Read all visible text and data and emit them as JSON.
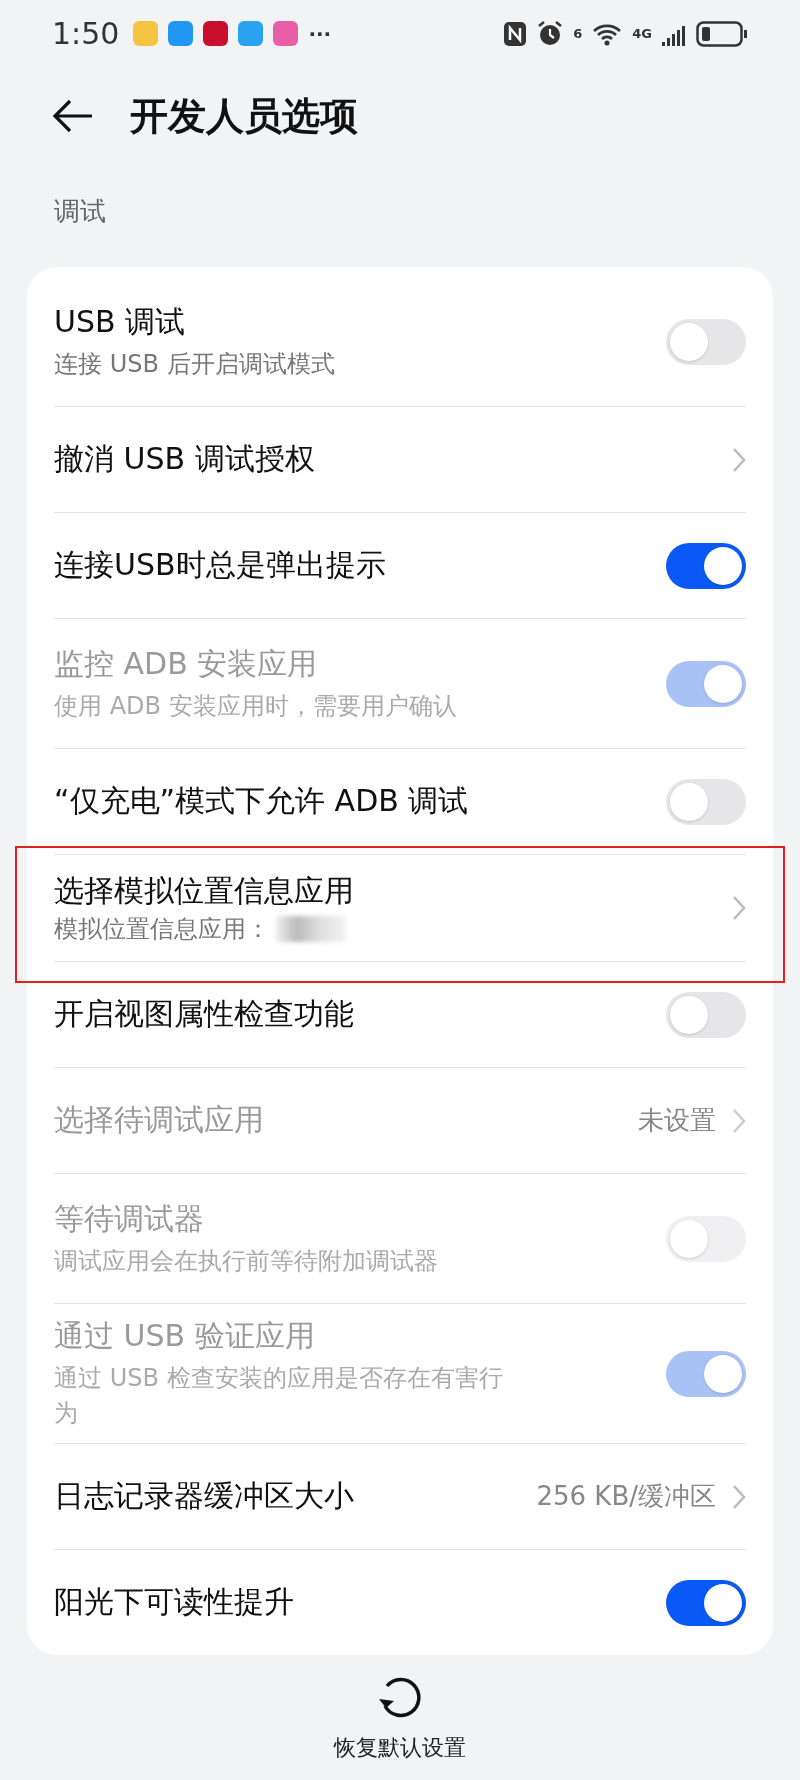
{
  "status_bar": {
    "time": "1:50",
    "more": "···",
    "apps": [
      {
        "color": "#f5c542"
      },
      {
        "color": "#2196f3"
      },
      {
        "color": "#c8102e"
      },
      {
        "color": "#29a3f0"
      },
      {
        "color": "#e85fa8"
      }
    ],
    "wifi_badge": "6",
    "network": "4G"
  },
  "header": {
    "title": "开发人员选项"
  },
  "section": {
    "title": "调试"
  },
  "rows": [
    {
      "kind": "switch",
      "title": "USB 调试",
      "subtitle": "连接 USB 后开启调试模式",
      "on": false,
      "disabled": false,
      "highlighted": false
    },
    {
      "kind": "link",
      "title": "撤消 USB 调试授权",
      "disabled": false,
      "highlighted": false
    },
    {
      "kind": "switch",
      "title": "连接USB时总是弹出提示",
      "on": true,
      "disabled": false,
      "highlighted": false
    },
    {
      "kind": "switch",
      "title": "监控 ADB 安装应用",
      "subtitle": "使用 ADB 安装应用时，需要用户确认",
      "on": true,
      "disabled": true,
      "highlighted": false
    },
    {
      "kind": "switch",
      "title": "“仅充电”模式下允许 ADB 调试",
      "on": false,
      "disabled": false,
      "highlighted": false
    },
    {
      "kind": "link",
      "title": "选择模拟位置信息应用",
      "subtitle": "模拟位置信息应用：",
      "blurred": true,
      "disabled": false,
      "highlighted": true
    },
    {
      "kind": "switch",
      "title": "开启视图属性检查功能",
      "on": false,
      "disabled": false,
      "highlighted": false
    },
    {
      "kind": "link",
      "title": "选择待调试应用",
      "value": "未设置",
      "disabled": true,
      "highlighted": false
    },
    {
      "kind": "switch",
      "title": "等待调试器",
      "subtitle": "调试应用会在执行前等待附加调试器",
      "on": false,
      "disabled": true,
      "highlighted": false
    },
    {
      "kind": "switch",
      "title": "通过 USB 验证应用",
      "subtitle": "通过 USB 检查安装的应用是否存在有害行为",
      "on": true,
      "disabled": true,
      "highlighted": false
    },
    {
      "kind": "link",
      "title": "日志记录器缓冲区大小",
      "value": "256 KB/缓冲区",
      "disabled": false,
      "highlighted": false
    },
    {
      "kind": "switch",
      "title": "阳光下可读性提升",
      "on": true,
      "disabled": false,
      "highlighted": false
    }
  ],
  "bottom_action": {
    "label": "恢复默认设置"
  }
}
